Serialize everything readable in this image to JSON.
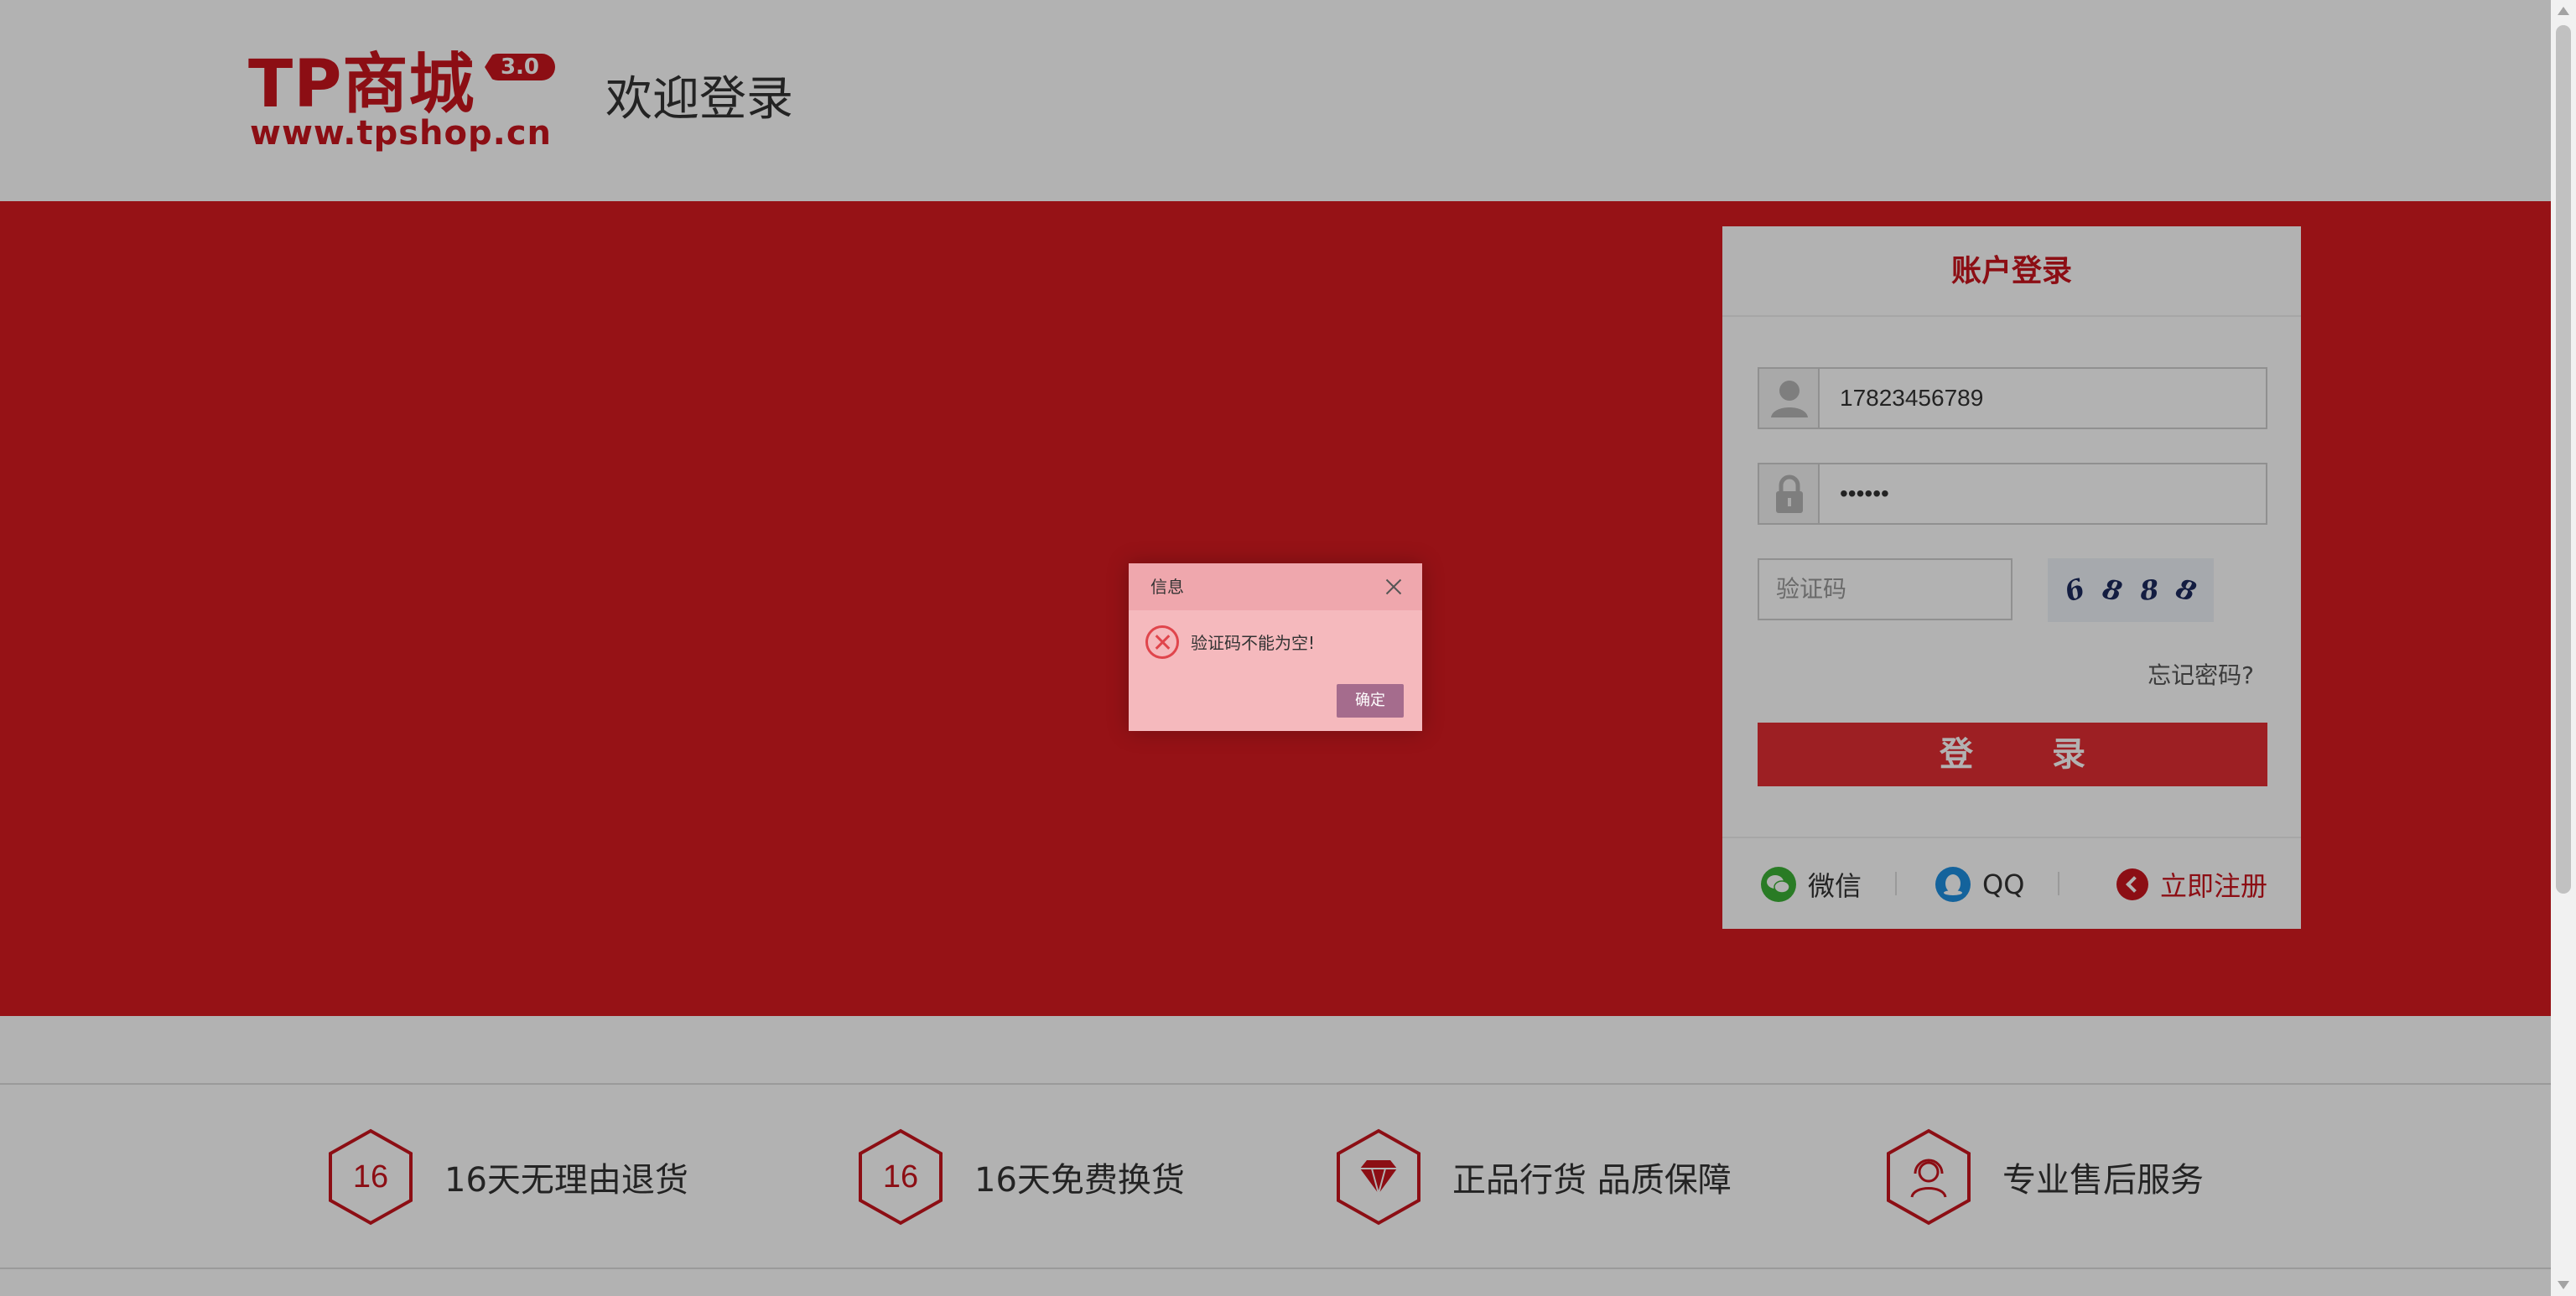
{
  "header": {
    "logo_text": "TP商城",
    "logo_version": "3.0",
    "logo_url": "www.tpshop.cn",
    "welcome": "欢迎登录"
  },
  "login": {
    "title": "账户登录",
    "username": "17823456789",
    "password": "••••••",
    "captcha_placeholder": "验证码",
    "captcha_chars": [
      "6",
      "8",
      "8",
      "8"
    ],
    "forgot": "忘记密码?",
    "submit": "登 录",
    "social": {
      "wechat": "微信",
      "qq": "QQ"
    },
    "register": "立即注册"
  },
  "features": [
    {
      "num": "16",
      "icon": "hexagon-number-icon",
      "text": "16天无理由退货"
    },
    {
      "num": "16",
      "icon": "hexagon-number-icon",
      "text": "16天免费换货"
    },
    {
      "num": "",
      "icon": "diamond-icon",
      "text": "正品行货 品质保障"
    },
    {
      "num": "",
      "icon": "customer-service-icon",
      "text": "专业售后服务"
    }
  ],
  "dialog": {
    "title": "信息",
    "message": "验证码不能为空!",
    "ok": "确定"
  },
  "colors": {
    "brand_red": "#c9151e",
    "banner_red": "#d71a20",
    "button_red": "#e12d33",
    "overlay": "rgba(0,0,0,0.3)"
  }
}
